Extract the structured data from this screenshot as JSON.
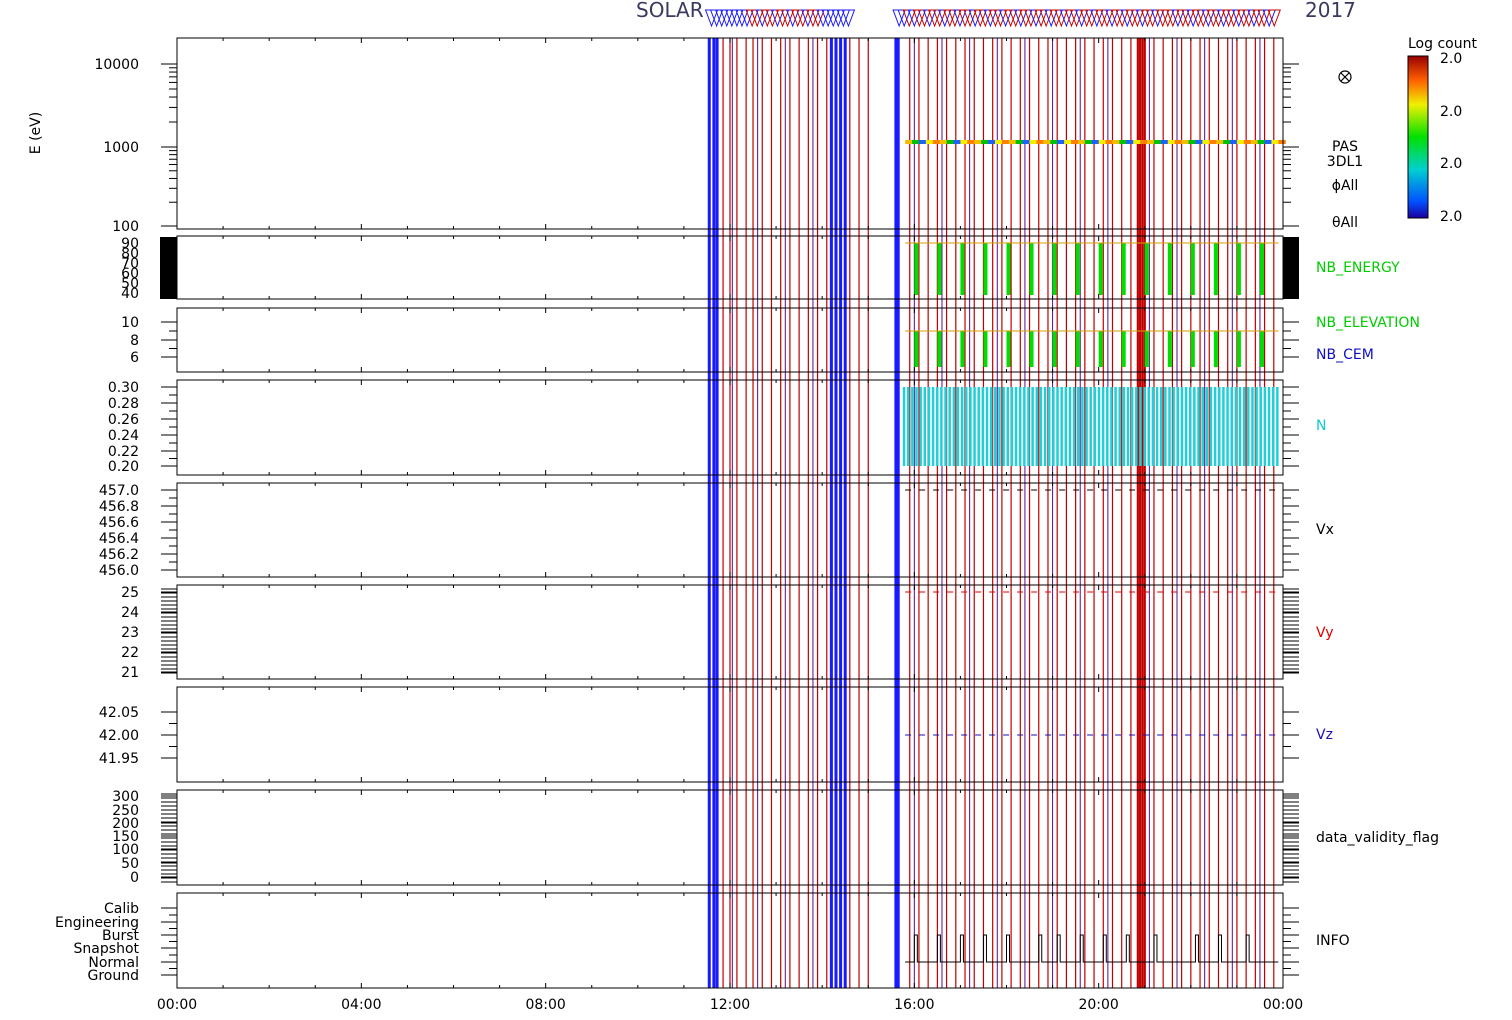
{
  "title": "SOLAR",
  "title_year": "2017",
  "colorbar": {
    "title": "Log count",
    "tick_labels": [
      "2.0",
      "2.0",
      "2.0",
      "2.0"
    ]
  },
  "x_ticks": [
    "00:00",
    "04:00",
    "08:00",
    "12:00",
    "16:00",
    "20:00",
    "00:00"
  ],
  "x_range_hours": [
    0,
    24
  ],
  "colors": {
    "blue_line": "#1a1aff",
    "red_line": "#c00000",
    "purple_line": "#5a0a8a",
    "green_trace": "#00dd00",
    "cyan_trace": "#20d0d8",
    "label_green": "#00cc00",
    "label_blue": "#1010c0",
    "label_cyan": "#10c8d8",
    "label_red": "#e00000",
    "label_purple": "#2010b0"
  },
  "chart_data": {
    "type": "line",
    "panels": [
      {
        "id": "energy",
        "ylabel": "E (eV)",
        "ticks": [
          "10000",
          "1000",
          "100"
        ],
        "log": true,
        "ylim": [
          100,
          20000
        ],
        "labels": [
          "PAS",
          "3DL1",
          "ϕAll",
          "θAll"
        ],
        "trace": {
          "t_start": 15.8,
          "t_end": 23.9,
          "value": 1100
        }
      },
      {
        "id": "nb_energy",
        "ylabel": "",
        "ticks": [
          "90",
          "80",
          "70",
          "60",
          "50",
          "40"
        ],
        "ylim": [
          35,
          95
        ],
        "labels": [
          "NB_ENERGY"
        ]
      },
      {
        "id": "nb_elev",
        "ylabel": "",
        "ticks": [
          "10",
          "8",
          "6"
        ],
        "ylim": [
          4.5,
          11.5
        ],
        "labels": [
          "NB_ELEVATION",
          "NB_CEM"
        ]
      },
      {
        "id": "n",
        "ylabel": "",
        "ticks": [
          "0.30",
          "0.28",
          "0.26",
          "0.24",
          "0.22",
          "0.20"
        ],
        "ylim": [
          0.19,
          0.31
        ],
        "labels": [
          "N"
        ]
      },
      {
        "id": "vx",
        "ylabel": "",
        "ticks": [
          "457.0",
          "456.8",
          "456.6",
          "456.4",
          "456.2",
          "456.0"
        ],
        "ylim": [
          455.9,
          457.1
        ],
        "labels": [
          "Vx"
        ]
      },
      {
        "id": "vy",
        "ylabel": "",
        "ticks": [
          "25",
          "24",
          "23",
          "22",
          "21"
        ],
        "ylim": [
          20.5,
          25.5
        ],
        "labels": [
          "Vy"
        ]
      },
      {
        "id": "vz",
        "ylabel": "",
        "ticks": [
          "42.05",
          "42.00",
          "41.95"
        ],
        "ylim": [
          41.92,
          42.08
        ],
        "labels": [
          "Vz"
        ]
      },
      {
        "id": "dvf",
        "ylabel": "",
        "ticks": [
          "300",
          "250",
          "200",
          "150",
          "100",
          "50",
          "0"
        ],
        "ylim": [
          -20,
          310
        ],
        "labels": [
          "data_validity_flag"
        ]
      },
      {
        "id": "info",
        "ylabel": "",
        "ticks": [
          "Calib",
          "Engineering",
          "Burst",
          "Snapshot",
          "Normal",
          "Ground"
        ],
        "ylim": [
          0,
          6
        ],
        "labels": [
          "INFO"
        ]
      }
    ],
    "blue_lines_h": [
      11.55,
      11.65,
      11.72,
      14.2,
      14.3,
      14.4,
      14.5,
      15.6,
      15.65
    ],
    "red_lines_h": [
      11.85,
      12.0,
      12.15,
      12.35,
      12.5,
      12.7,
      12.9,
      13.1,
      13.3,
      13.5,
      13.7,
      13.9,
      14.1,
      14.6,
      14.8,
      15.0,
      15.9,
      16.1,
      16.3,
      16.5,
      16.7,
      16.9,
      17.1,
      17.3,
      17.5,
      17.7,
      17.9,
      18.1,
      18.3,
      18.5,
      18.7,
      18.9,
      19.1,
      19.3,
      19.5,
      19.7,
      19.9,
      20.1,
      20.3,
      20.5,
      20.7,
      20.85,
      20.9,
      20.95,
      21.0,
      21.2,
      21.4,
      21.6,
      21.8,
      22.0,
      22.2,
      22.4,
      22.6,
      22.8,
      23.0,
      23.2,
      23.4,
      23.6,
      23.8
    ],
    "purple_lines_h": [
      12.05,
      12.6,
      13.2,
      13.8,
      16.0,
      16.6,
      17.2,
      17.8,
      18.4,
      19.0,
      19.6,
      20.2,
      21.1,
      21.7,
      22.3,
      22.9,
      23.5
    ],
    "green_pulses_h": [
      16.0,
      16.5,
      17.0,
      17.5,
      18.0,
      18.5,
      19.0,
      19.5,
      20.0,
      20.5,
      21.0,
      21.5,
      22.0,
      22.5,
      23.0,
      23.5
    ],
    "info_steps_h": [
      16.0,
      16.5,
      17.0,
      17.5,
      18.0,
      18.7,
      19.1,
      19.6,
      20.1,
      20.6,
      21.2,
      22.1,
      22.6,
      23.2
    ]
  }
}
